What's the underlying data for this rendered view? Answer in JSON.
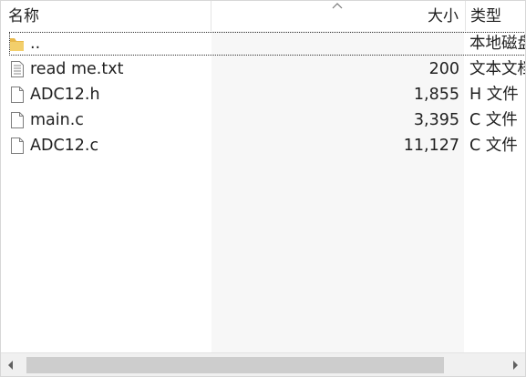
{
  "header": {
    "name_label": "名称",
    "size_label": "大小",
    "type_label": "类型",
    "sort_icon": "chevron-up-icon"
  },
  "files": [
    {
      "name": "..",
      "size": "",
      "type": "本地磁盘",
      "icon": "folder-icon"
    },
    {
      "name": "read me.txt",
      "size": "200",
      "type": "文本文档",
      "icon": "text-file-icon"
    },
    {
      "name": "ADC12.h",
      "size": "1,855",
      "type": "H 文件",
      "icon": "file-icon"
    },
    {
      "name": "main.c",
      "size": "3,395",
      "type": "C 文件",
      "icon": "file-icon"
    },
    {
      "name": "ADC12.c",
      "size": "11,127",
      "type": "C 文件",
      "icon": "file-icon"
    }
  ],
  "scrollbar": {
    "left_icon": "arrow-left-icon",
    "right_icon": "arrow-right-icon"
  },
  "colors": {
    "sorted_column": "#f7f7f7",
    "folder": "#e8b84a",
    "scroll_thumb": "#cdcdcd"
  }
}
